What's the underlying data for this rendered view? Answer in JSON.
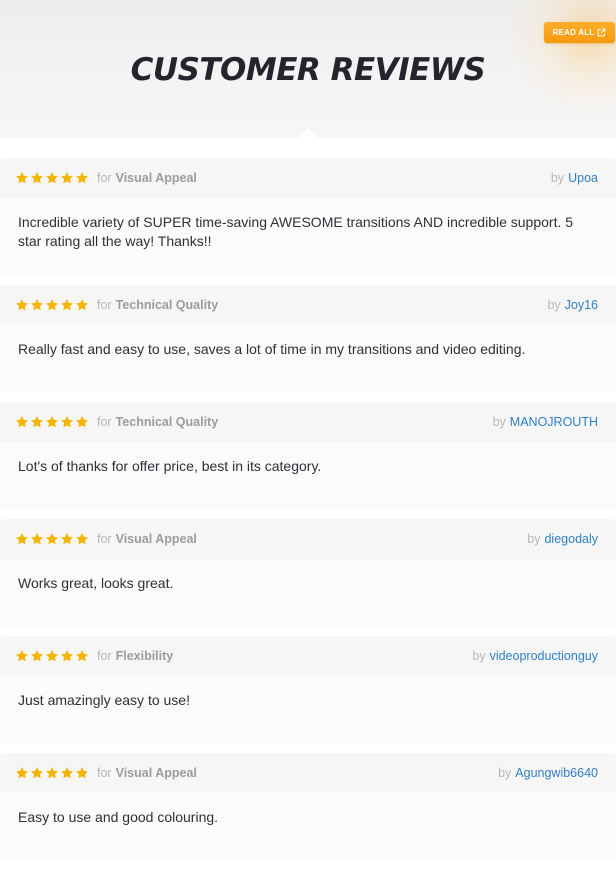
{
  "header": {
    "title": "CUSTOMER REVIEWS",
    "read_all_label": "READ ALL",
    "read_all_icon": "external-link-icon"
  },
  "colors": {
    "accent": "#f7a21b",
    "star": "#f5b400",
    "author_link": "#2f7fc6"
  },
  "review_labels": {
    "for": "for",
    "by": "by"
  },
  "reviews": [
    {
      "rating": 5,
      "category": "Visual Appeal",
      "author": "Upoa",
      "text": "Incredible variety of SUPER time-saving AWESOME transitions AND incredible support. 5 star rating all the way! Thanks!!"
    },
    {
      "rating": 5,
      "category": "Technical Quality",
      "author": "Joy16",
      "text": "Really fast and easy to use, saves a lot of time in my transitions and video editing."
    },
    {
      "rating": 5,
      "category": "Technical Quality",
      "author": "MANOJROUTH",
      "text": "Lot's of thanks for offer price, best in its category."
    },
    {
      "rating": 5,
      "category": "Visual Appeal",
      "author": "diegodaly",
      "text": "Works great, looks great."
    },
    {
      "rating": 5,
      "category": "Flexibility",
      "author": "videoproductionguy",
      "text": "Just amazingly easy to use!"
    },
    {
      "rating": 5,
      "category": "Visual Appeal",
      "author": "Agungwib6640",
      "text": "Easy to use and good colouring."
    }
  ]
}
